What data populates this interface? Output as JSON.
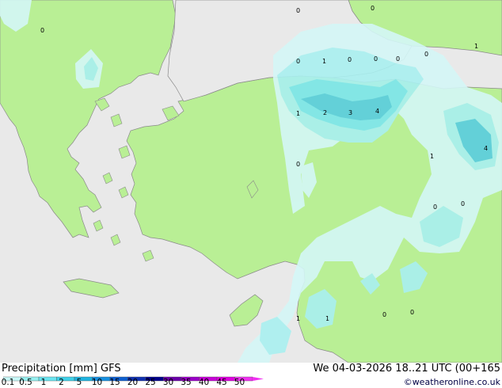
{
  "map": {
    "value_labels": [
      {
        "id": "a",
        "text": "0"
      },
      {
        "id": "b",
        "text": "0"
      },
      {
        "id": "c",
        "text": "0"
      },
      {
        "id": "d",
        "text": "1"
      },
      {
        "id": "e",
        "text": "0"
      },
      {
        "id": "f",
        "text": "1"
      },
      {
        "id": "g",
        "text": "0"
      },
      {
        "id": "h",
        "text": "0"
      },
      {
        "id": "i",
        "text": "0"
      },
      {
        "id": "j",
        "text": "0"
      },
      {
        "id": "k",
        "text": "1"
      },
      {
        "id": "l",
        "text": "2"
      },
      {
        "id": "m",
        "text": "3"
      },
      {
        "id": "n",
        "text": "4"
      },
      {
        "id": "o",
        "text": "4"
      },
      {
        "id": "p",
        "text": "0"
      },
      {
        "id": "q",
        "text": "1"
      },
      {
        "id": "r",
        "text": "0"
      },
      {
        "id": "s",
        "text": "0"
      },
      {
        "id": "t",
        "text": "1"
      },
      {
        "id": "u",
        "text": "1"
      },
      {
        "id": "v",
        "text": "0"
      },
      {
        "id": "w",
        "text": "0"
      }
    ],
    "colors": {
      "sea": "#e9e9e9",
      "land_dry": "#b9ef95",
      "precip_0_1": "#d4f7f7",
      "precip_0_5": "#a9f0f0",
      "precip_1": "#7ee6ee",
      "precip_2": "#5acde0",
      "border": "#8a8a8a"
    }
  },
  "footer": {
    "title": "Precipitation [mm]  GFS",
    "datetime": "We 04-03-2026  18..21 UTC (00+165",
    "credit": "©weatheronline.co.uk",
    "legend": {
      "ticks": [
        "0.1",
        "0.5",
        "1",
        "2",
        "5",
        "10",
        "15",
        "20",
        "25",
        "30",
        "35",
        "40",
        "45",
        "50"
      ],
      "colors": [
        "#c8f8f8",
        "#96f0f0",
        "#6ae4f0",
        "#40d0e8",
        "#20b4e0",
        "#1890e0",
        "#1060d0",
        "#1030b0",
        "#00008a",
        "#6a00a8",
        "#9a00c8",
        "#c800d8",
        "#e000e0",
        "#f030f0"
      ]
    }
  }
}
